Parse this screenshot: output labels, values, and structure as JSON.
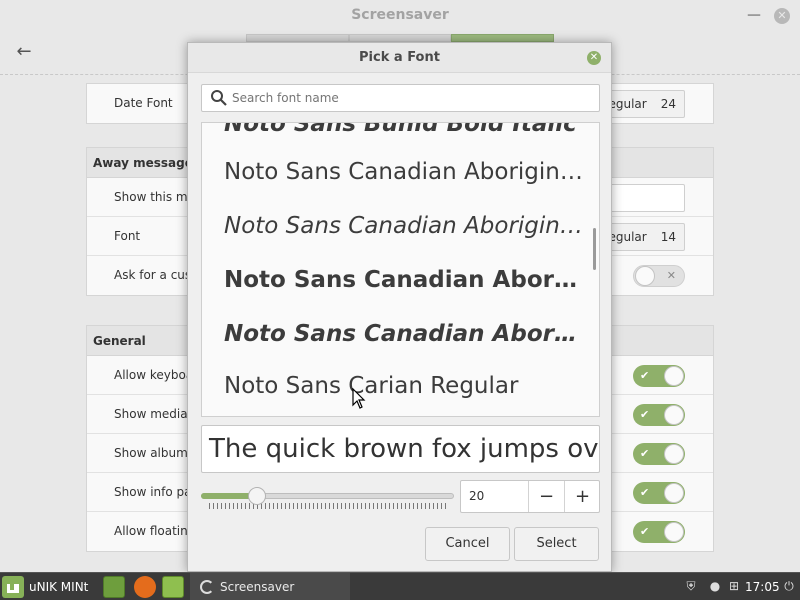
{
  "window": {
    "title": "Screensaver"
  },
  "sections": {
    "date": {
      "rows": [
        {
          "label": "Date Font",
          "font_style": "Regular",
          "font_size": "24"
        }
      ]
    },
    "away": {
      "title": "Away message",
      "rows": [
        {
          "label": "Show this message"
        },
        {
          "label": "Font",
          "font_style": "Regular",
          "font_size": "14"
        },
        {
          "label": "Ask for a custom message"
        }
      ]
    },
    "general": {
      "title": "General",
      "rows": [
        {
          "label": "Allow keyboard shortcuts"
        },
        {
          "label": "Show media player controls"
        },
        {
          "label": "Show album art"
        },
        {
          "label": "Show info panel"
        },
        {
          "label": "Allow floating clock and album art widgets"
        }
      ]
    }
  },
  "dialog": {
    "title": "Pick a Font",
    "search_placeholder": "Search font name",
    "fonts": [
      "Noto Sans Buhid Bold Italic",
      "Noto Sans Canadian Aboriginal Regular",
      "Noto Sans Canadian Aboriginal Italic",
      "Noto Sans Canadian Aboriginal Bold",
      "Noto Sans Canadian Aboriginal Bold Italic",
      "Noto Sans Carian Regular"
    ],
    "preview_text": "The quick brown fox jumps over the lazy dog",
    "size_value": "20",
    "size_fraction": 0.2,
    "minus_label": "−",
    "plus_label": "+",
    "cancel_label": "Cancel",
    "select_label": "Select"
  },
  "taskbar": {
    "menu_label": "uNIK MINt",
    "task_label": "Screensaver",
    "clock": "17:05"
  },
  "colors": {
    "accent": "#8fb06a",
    "taskbar": "#3a3a3a"
  }
}
